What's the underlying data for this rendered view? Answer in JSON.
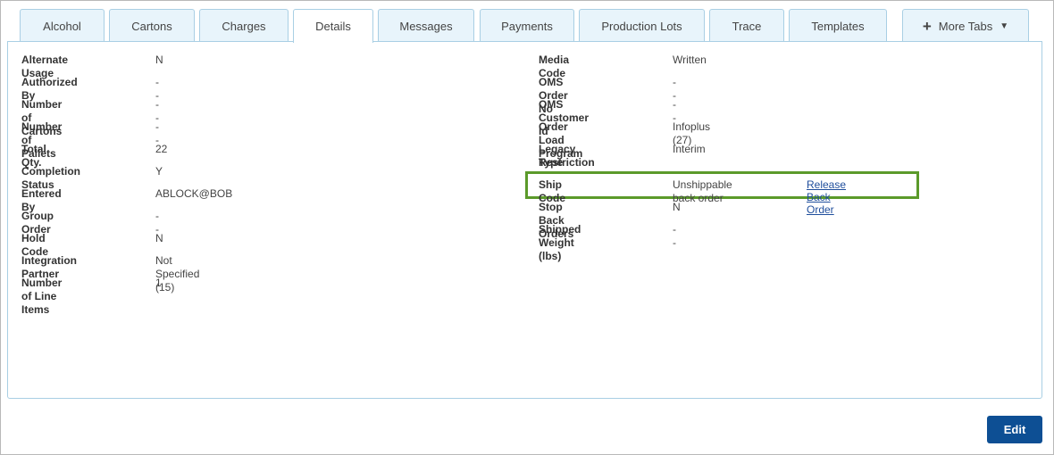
{
  "tabs": [
    {
      "label": "Alcohol"
    },
    {
      "label": "Cartons"
    },
    {
      "label": "Charges"
    },
    {
      "label": "Details"
    },
    {
      "label": "Messages"
    },
    {
      "label": "Payments"
    },
    {
      "label": "Production Lots"
    },
    {
      "label": "Trace"
    },
    {
      "label": "Templates"
    }
  ],
  "more_tabs": {
    "label": "More Tabs"
  },
  "left_fields": [
    {
      "label": "Alternate Usage",
      "value": "N"
    },
    {
      "label": "Authorized By",
      "value": "--"
    },
    {
      "label": "Number of Cartons",
      "value": "--"
    },
    {
      "label": "Number of Pallets",
      "value": "--"
    },
    {
      "label": "Total Qty.",
      "value": "22"
    },
    {
      "label": "Completion Status",
      "value": "Y"
    },
    {
      "label": "Entered By",
      "value": "ABLOCK@BOB"
    },
    {
      "label": "Group Order",
      "value": "--"
    },
    {
      "label": "Hold Code",
      "value": "N"
    },
    {
      "label": "Integration Partner",
      "value": "Not Specified (15)"
    },
    {
      "label": "Number of Line Items",
      "value": "1"
    }
  ],
  "right_fields": [
    {
      "label": "Media Code",
      "value": "Written"
    },
    {
      "label": "OMS Order No",
      "value": "--"
    },
    {
      "label": "OMS Customer Id",
      "value": "--"
    },
    {
      "label": "Order Load Program",
      "value": "Infoplus (27)"
    },
    {
      "label": "Legacy Restriction",
      "label2": "Type",
      "value": "Interim"
    },
    {
      "label": "Ship Code",
      "value": "Unshippable back order",
      "link": "Release Back Order"
    },
    {
      "label": "Stop Back Orders",
      "value": "N"
    },
    {
      "label": "Shipped Weight (lbs)",
      "value": "--"
    }
  ],
  "actions": {
    "edit_label": "Edit"
  },
  "colors": {
    "highlight": "#5b9a2a",
    "primary_button": "#0d4f94",
    "link": "#1f4e9c",
    "tab_bg": "#e8f4fb"
  }
}
